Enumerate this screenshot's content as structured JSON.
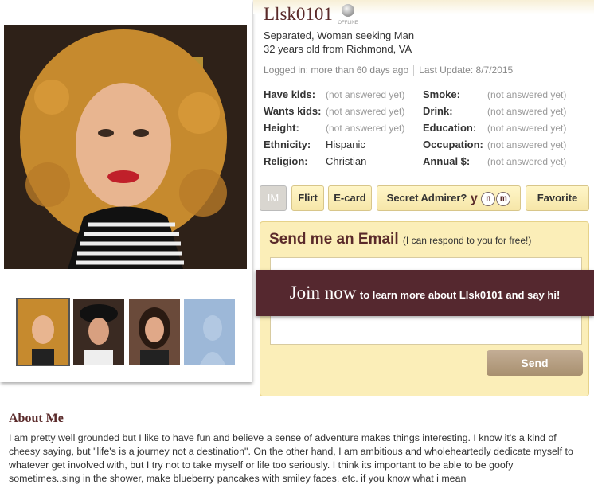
{
  "profile": {
    "username": "Llsk0101",
    "status_icon": "offline-icon",
    "status_label": "OFFLINE",
    "summary_line1": "Separated, Woman seeking Man",
    "summary_line2": "32 years old from Richmond, VA",
    "logged_in": "Logged in: more than 60 days ago",
    "last_update": "Last Update: 8/7/2015"
  },
  "attributes": {
    "left": [
      {
        "label": "Have kids:",
        "value": "(not answered yet)"
      },
      {
        "label": "Wants kids:",
        "value": "(not answered yet)"
      },
      {
        "label": "Height:",
        "value": "(not answered yet)"
      },
      {
        "label": "Ethnicity:",
        "value": "Hispanic"
      },
      {
        "label": "Religion:",
        "value": "Christian"
      }
    ],
    "right": [
      {
        "label": "Smoke:",
        "value": "(not answered yet)"
      },
      {
        "label": "Drink:",
        "value": "(not answered yet)"
      },
      {
        "label": "Education:",
        "value": "(not answered yet)"
      },
      {
        "label": "Occupation:",
        "value": "(not answered yet)"
      },
      {
        "label": "Annual $:",
        "value": "(not answered yet)"
      }
    ]
  },
  "actions": {
    "im": "IM",
    "flirt": "Flirt",
    "ecard": "E-card",
    "secret_admirer": "Secret Admirer?",
    "sa_yes": "y",
    "sa_no": "n",
    "sa_maybe": "m",
    "favorite": "Favorite"
  },
  "email": {
    "title": "Send me an Email",
    "note": "(I can respond to you for free!)",
    "send": "Send"
  },
  "join": {
    "big": "Join now",
    "small": "to learn more about Llsk0101 and say hi!"
  },
  "about": {
    "title": "About Me",
    "text": "I am pretty well grounded but I like to have fun and believe a sense of adventure makes things interesting. I know it's a kind of cheesy saying, but \"life's is a journey not a destination\". On the other hand, I am ambitious and wholeheartedly dedicate myself to whatever get involved with, but I try not to take myself or life too seriously. I think its important to be able to be goofy sometimes..sing in the shower, make blueberry pancakes with smiley faces, etc. if you know what i mean"
  },
  "colors": {
    "brand": "#5a2a2a",
    "banner": "#55282f",
    "button": "#f6e6a8",
    "email_bg": "#fbeeb8"
  }
}
